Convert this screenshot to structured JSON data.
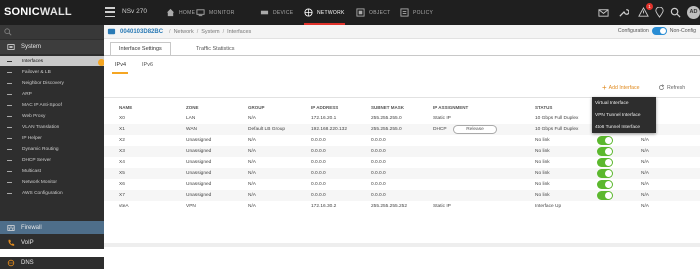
{
  "brand": {
    "name_left": "SONIC",
    "name_right": "WALL"
  },
  "topbar": {
    "model": "NSv 270",
    "tabs": [
      {
        "label": "HOME",
        "icon": "home-icon"
      },
      {
        "label": "MONITOR",
        "icon": "monitor-icon"
      },
      {
        "label": "DEVICE",
        "icon": "device-icon"
      },
      {
        "label": "NETWORK",
        "icon": "network-icon",
        "active": true
      },
      {
        "label": "OBJECT",
        "icon": "object-icon"
      },
      {
        "label": "POLICY",
        "icon": "policy-icon"
      }
    ],
    "notification_count": "1",
    "avatar_initials": "AD"
  },
  "sidebar": {
    "sections": {
      "system": "System",
      "firewall": "Firewall",
      "voip": "VoIP",
      "dns": "DNS"
    },
    "items": [
      "Interfaces",
      "Failover & LB",
      "Neighbor Discovery",
      "ARP",
      "MAC IP Anti-Spoof",
      "Web Proxy",
      "VLAN Translation",
      "IP Helper",
      "Dynamic Routing",
      "DHCP Server",
      "Multicast",
      "Network Monitor",
      "AWS Configuration"
    ],
    "active_item": "Interfaces"
  },
  "breadcrumb": {
    "serial": "0040103D82BC",
    "path": [
      "Network",
      "System",
      "Interfaces"
    ]
  },
  "mode": {
    "left": "Configuration",
    "right": "Non-Config"
  },
  "tabs": {
    "interface_settings": "Interface Settings",
    "traffic_statistics": "Traffic Statistics"
  },
  "subtabs": {
    "ipv4": "IPv4",
    "ipv6": "IPv6"
  },
  "actions": {
    "add_interface": "Add Interface",
    "refresh": "Refresh"
  },
  "add_menu": [
    "Virtual Interface",
    "VPN Tunnel Interface",
    "4to6 Tunnel Interface"
  ],
  "table": {
    "headers": {
      "name": "NAME",
      "zone": "ZONE",
      "group": "GROUP",
      "ip": "IP ADDRESS",
      "mask": "SUBNET MASK",
      "assign": "IP ASSIGNMENT",
      "status": "STATUS",
      "mgmt": "MENT"
    },
    "rows": [
      {
        "name": "X0",
        "zone": "LAN",
        "group": "N/A",
        "ip": "172.16.20.1",
        "mask": "255.255.255.0",
        "assign": "Static IP",
        "status": "10 Gbps Full Duplex",
        "mgmt": "AN"
      },
      {
        "name": "X1",
        "zone": "WAN",
        "group": "Default LB Group",
        "ip": "192.168.220.132",
        "mask": "255.255.255.0",
        "assign": "DHCP",
        "release": "Release",
        "status": "10 Gbps Full Duplex",
        "mgmt": "AN"
      },
      {
        "name": "X2",
        "zone": "Unassigned",
        "group": "N/A",
        "ip": "0.0.0.0",
        "mask": "0.0.0.0",
        "assign": "",
        "status": "No link",
        "mgmt": "N/A",
        "toggle": true
      },
      {
        "name": "X3",
        "zone": "Unassigned",
        "group": "N/A",
        "ip": "0.0.0.0",
        "mask": "0.0.0.0",
        "assign": "",
        "status": "No link",
        "mgmt": "N/A",
        "toggle": true
      },
      {
        "name": "X4",
        "zone": "Unassigned",
        "group": "N/A",
        "ip": "0.0.0.0",
        "mask": "0.0.0.0",
        "assign": "",
        "status": "No link",
        "mgmt": "N/A",
        "toggle": true
      },
      {
        "name": "X5",
        "zone": "Unassigned",
        "group": "N/A",
        "ip": "0.0.0.0",
        "mask": "0.0.0.0",
        "assign": "",
        "status": "No link",
        "mgmt": "N/A",
        "toggle": true
      },
      {
        "name": "X6",
        "zone": "Unassigned",
        "group": "N/A",
        "ip": "0.0.0.0",
        "mask": "0.0.0.0",
        "assign": "",
        "status": "No link",
        "mgmt": "N/A",
        "toggle": true
      },
      {
        "name": "X7",
        "zone": "Unassigned",
        "group": "N/A",
        "ip": "0.0.0.0",
        "mask": "0.0.0.0",
        "assign": "",
        "status": "No link",
        "mgmt": "N/A",
        "toggle": true
      },
      {
        "name": "vteA",
        "zone": "VPN",
        "group": "N/A",
        "ip": "172.16.30.2",
        "mask": "255.255.255.252",
        "assign": "Static IP",
        "status": "Interface Up",
        "mgmt": "N/A"
      }
    ]
  },
  "colors": {
    "accent": "#f5a623",
    "active_nav": "#e0322b",
    "link": "#2a7ab5",
    "toggle_on": "#5cb82e"
  }
}
